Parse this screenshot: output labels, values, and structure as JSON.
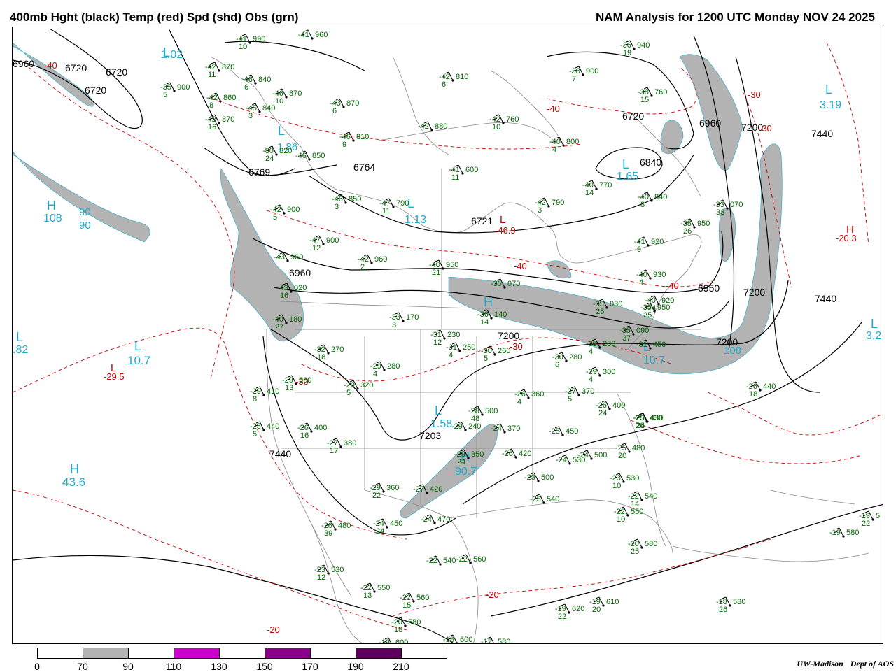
{
  "titles": {
    "left": "400mb Hght (black) Temp (red) Spd (shd) Obs (grn)",
    "right": "NAM Analysis for 1200 UTC Monday  NOV 24 2025"
  },
  "colors": {
    "height": "#000000",
    "temp": "#cc0000",
    "speed_shade": "#b3b3b3",
    "obs": "#006600",
    "center_label": "#22aacc",
    "borders": "#888888"
  },
  "legend": {
    "ticks": [
      "0",
      "70",
      "90",
      "110",
      "130",
      "150",
      "170",
      "190",
      "210"
    ],
    "fills": [
      "#ffffff",
      "#b3b3b3",
      "#ffffff",
      "#cc00cc",
      "#ffffff",
      "#8a008a",
      "#ffffff",
      "#5c005c"
    ]
  },
  "credit": {
    "institution": "UW-Madison",
    "dept": "Dept of AOS"
  },
  "height_labels": [
    "6960",
    "6720",
    "6720",
    "6720",
    "6769",
    "6764",
    "6721",
    "6720",
    "6960",
    "6840",
    "7200",
    "7440",
    "7440",
    "6960",
    "6950",
    "7200",
    "7200",
    "7200",
    "7203",
    "7440"
  ],
  "temp_labels": [
    "-40",
    "-40",
    "-40",
    "-30",
    "-30",
    "-30",
    "-20",
    "-20",
    "-30",
    "-40"
  ],
  "centers": [
    {
      "kind": "L",
      "value": "1.02",
      "color": "cyan"
    },
    {
      "kind": "L",
      "value": "1.86",
      "color": "cyan"
    },
    {
      "kind": "H",
      "value": "108",
      "color": "cyan"
    },
    {
      "kind": "H",
      "value": "90",
      "color": "cyan"
    },
    {
      "kind": "L",
      "value": "1.13",
      "color": "cyan"
    },
    {
      "kind": "L",
      "value": "-46.9",
      "color": "red"
    },
    {
      "kind": "L",
      "value": "1.65",
      "color": "cyan"
    },
    {
      "kind": "L",
      "value": "3.19",
      "color": "cyan"
    },
    {
      "kind": "H",
      "value": "-20.3",
      "color": "red"
    },
    {
      "kind": "L",
      "value": "3.2",
      "color": "cyan"
    },
    {
      "kind": "L",
      "value": ".82",
      "color": "cyan"
    },
    {
      "kind": "L",
      "value": "10.7",
      "color": "cyan"
    },
    {
      "kind": "L",
      "value": "-29.5",
      "color": "red"
    },
    {
      "kind": "H",
      "value": "43.6",
      "color": "cyan"
    },
    {
      "kind": "L",
      "value": "1.58",
      "color": "cyan"
    },
    {
      "kind": "H",
      "value": "90.7",
      "color": "cyan"
    },
    {
      "kind": "L",
      "value": "10.7",
      "color": "cyan"
    },
    {
      "kind": "H",
      "value": "108",
      "color": "cyan"
    }
  ],
  "obs": [
    {
      "t": "-41",
      "h": "990",
      "d": "10"
    },
    {
      "t": "-41",
      "h": "960",
      "d": ""
    },
    {
      "t": "-42",
      "h": "870",
      "d": "11"
    },
    {
      "t": "-35",
      "h": "900",
      "d": "5"
    },
    {
      "t": "-46",
      "h": "840",
      "d": "6"
    },
    {
      "t": "-42",
      "h": "860",
      "d": "8"
    },
    {
      "t": "-46",
      "h": "870",
      "d": "10"
    },
    {
      "t": "-45",
      "h": "840",
      "d": "3"
    },
    {
      "t": "-42",
      "h": "870",
      "d": "16"
    },
    {
      "t": "-43",
      "h": "870",
      "d": "6"
    },
    {
      "t": "-42",
      "h": "880",
      "d": ""
    },
    {
      "t": "-46",
      "h": "810",
      "d": "9"
    },
    {
      "t": "-80",
      "h": "820",
      "d": "24"
    },
    {
      "t": "-46",
      "h": "850",
      "d": ""
    },
    {
      "t": "-42",
      "h": "760",
      "d": "10"
    },
    {
      "t": "-40",
      "h": "800",
      "d": "4"
    },
    {
      "t": "-36",
      "h": "940",
      "d": "19"
    },
    {
      "t": "-38",
      "h": "900",
      "d": "7"
    },
    {
      "t": "-38",
      "h": "760",
      "d": "15"
    },
    {
      "t": "-41",
      "h": "600",
      "d": "11"
    },
    {
      "t": "-46",
      "h": "850",
      "d": "3"
    },
    {
      "t": "-47",
      "h": "790",
      "d": "11"
    },
    {
      "t": "-42",
      "h": "790",
      "d": "3"
    },
    {
      "t": "-40",
      "h": "770",
      "d": "14"
    },
    {
      "t": "-40",
      "h": "840",
      "d": "8"
    },
    {
      "t": "-33",
      "h": "070",
      "d": "33"
    },
    {
      "t": "-38",
      "h": "950",
      "d": "26"
    },
    {
      "t": "-41",
      "h": "920",
      "d": "9"
    },
    {
      "t": "-42",
      "h": "900",
      "d": "5"
    },
    {
      "t": "-47",
      "h": "900",
      "d": "12"
    },
    {
      "t": "-42",
      "h": "960",
      "d": "2"
    },
    {
      "t": "-43",
      "h": "960",
      "d": ""
    },
    {
      "t": "-43",
      "h": "020",
      "d": "16"
    },
    {
      "t": "-40",
      "h": "950",
      "d": "21"
    },
    {
      "t": "-35",
      "h": "070",
      "d": ""
    },
    {
      "t": "-40",
      "h": "930",
      "d": "4"
    },
    {
      "t": "-40",
      "h": "920",
      "d": "24"
    },
    {
      "t": "-40",
      "h": "180",
      "d": "27"
    },
    {
      "t": "-33",
      "h": "170",
      "d": "3"
    },
    {
      "t": "-31",
      "h": "230",
      "d": "12"
    },
    {
      "t": "-31",
      "h": "250",
      "d": "4"
    },
    {
      "t": "-30",
      "h": "260",
      "d": "5"
    },
    {
      "t": "-36",
      "h": "140",
      "d": "14"
    },
    {
      "t": "-35",
      "h": "030",
      "d": "25"
    },
    {
      "t": "-35",
      "h": "950",
      "d": "25"
    },
    {
      "t": "-35",
      "h": "090",
      "d": "37"
    },
    {
      "t": "-35",
      "h": "200",
      "d": "4"
    },
    {
      "t": "-31",
      "h": "450",
      "d": ""
    },
    {
      "t": "-32",
      "h": "270",
      "d": "18"
    },
    {
      "t": "-29",
      "h": "280",
      "d": "4"
    },
    {
      "t": "-30",
      "h": "280",
      "d": "6"
    },
    {
      "t": "-29",
      "h": "300",
      "d": "4"
    },
    {
      "t": "-29",
      "h": "360",
      "d": "13"
    },
    {
      "t": "-29",
      "h": "410",
      "d": "8"
    },
    {
      "t": "-29",
      "h": "320",
      "d": "5"
    },
    {
      "t": "-26",
      "h": "360",
      "d": "4"
    },
    {
      "t": "-27",
      "h": "370",
      "d": "5"
    },
    {
      "t": "-26",
      "h": "400",
      "d": "24"
    },
    {
      "t": "-26",
      "h": "430",
      "d": "26"
    },
    {
      "t": "-26",
      "h": "440",
      "d": "18"
    },
    {
      "t": "-25",
      "h": "440",
      "d": "5"
    },
    {
      "t": "-26",
      "h": "400",
      "d": "16"
    },
    {
      "t": "-27",
      "h": "380",
      "d": "17"
    },
    {
      "t": "-28",
      "h": "500",
      "d": "48"
    },
    {
      "t": "-29",
      "h": "240",
      "d": ""
    },
    {
      "t": "-24",
      "h": "370",
      "d": ""
    },
    {
      "t": "-25",
      "h": "450",
      "d": ""
    },
    {
      "t": "-25",
      "h": "480",
      "d": "20"
    },
    {
      "t": "-25",
      "h": "430",
      "d": "24"
    },
    {
      "t": "-26",
      "h": "420",
      "d": ""
    },
    {
      "t": "-29",
      "h": "350",
      "d": "24"
    },
    {
      "t": "-24",
      "h": "530",
      "d": ""
    },
    {
      "t": "-24",
      "h": "500",
      "d": ""
    },
    {
      "t": "-23",
      "h": "500",
      "d": ""
    },
    {
      "t": "-23",
      "h": "530",
      "d": "10"
    },
    {
      "t": "-22",
      "h": "540",
      "d": "14"
    },
    {
      "t": "-23",
      "h": "540",
      "d": ""
    },
    {
      "t": "-22",
      "h": "550",
      "d": "10"
    },
    {
      "t": "-29",
      "h": "360",
      "d": "22"
    },
    {
      "t": "-27",
      "h": "420",
      "d": ""
    },
    {
      "t": "-24",
      "h": "470",
      "d": ""
    },
    {
      "t": "-24",
      "h": "450",
      "d": "24"
    },
    {
      "t": "-26",
      "h": "480",
      "d": "39"
    },
    {
      "t": "-20",
      "h": "580",
      "d": "25"
    },
    {
      "t": "-22",
      "h": "540",
      "d": ""
    },
    {
      "t": "-22",
      "h": "560",
      "d": ""
    },
    {
      "t": "-23",
      "h": "530",
      "d": "12"
    },
    {
      "t": "-22",
      "h": "550",
      "d": "13"
    },
    {
      "t": "-22",
      "h": "560",
      "d": "15"
    },
    {
      "t": "-20",
      "h": "580",
      "d": "18"
    },
    {
      "t": "-19",
      "h": "600",
      "d": ""
    },
    {
      "t": "-18",
      "h": "600",
      "d": ""
    },
    {
      "t": "-17",
      "h": "580",
      "d": ""
    },
    {
      "t": "-19",
      "h": "620",
      "d": "22"
    },
    {
      "t": "-19",
      "h": "610",
      "d": "20"
    },
    {
      "t": "-18",
      "h": "580",
      "d": "26"
    },
    {
      "t": "-19",
      "h": "580",
      "d": ""
    },
    {
      "t": "-19",
      "h": "5",
      "d": "22"
    },
    {
      "t": "-42",
      "h": "810",
      "d": "6"
    }
  ]
}
